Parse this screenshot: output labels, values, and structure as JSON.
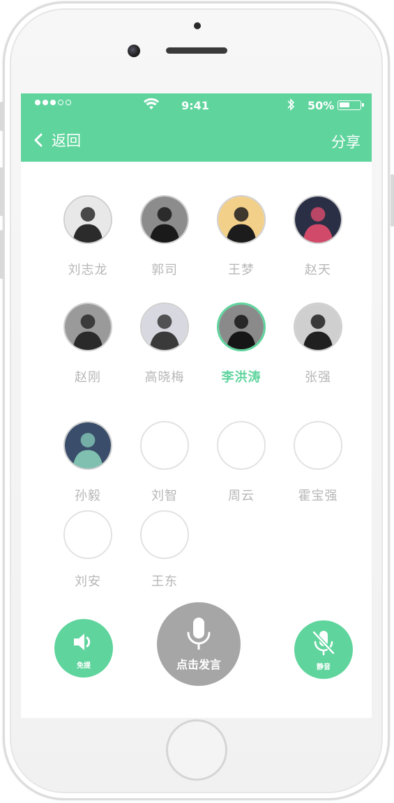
{
  "status_bar": {
    "carrier_dots": [
      "on",
      "on",
      "on",
      "off",
      "off"
    ],
    "time": "9:41",
    "battery_percent": "50%",
    "battery_level": 0.5
  },
  "nav": {
    "back_label": "返回",
    "share_label": "分享"
  },
  "members": [
    {
      "name": "刘志龙",
      "has_photo": true,
      "active": false
    },
    {
      "name": "郭司",
      "has_photo": true,
      "active": false
    },
    {
      "name": "王梦",
      "has_photo": true,
      "active": false
    },
    {
      "name": "赵天",
      "has_photo": true,
      "active": false
    },
    {
      "name": "赵刚",
      "has_photo": true,
      "active": false
    },
    {
      "name": "高晓梅",
      "has_photo": true,
      "active": false
    },
    {
      "name": "李洪涛",
      "has_photo": true,
      "active": true
    },
    {
      "name": "张强",
      "has_photo": true,
      "active": false
    },
    {
      "name": "孙毅",
      "has_photo": true,
      "active": false
    },
    {
      "name": "刘智",
      "has_photo": false,
      "active": false
    },
    {
      "name": "周云",
      "has_photo": false,
      "active": false
    },
    {
      "name": "霍宝强",
      "has_photo": false,
      "active": false
    },
    {
      "name": "刘安",
      "has_photo": false,
      "active": false
    },
    {
      "name": "王东",
      "has_photo": false,
      "active": false
    }
  ],
  "controls": {
    "speaker_label": "免提",
    "talk_label": "点击发言",
    "mute_label": "静音"
  },
  "colors": {
    "accent": "#5fd49d",
    "talk_button": "#a6a6a6",
    "name_text": "#b7b7b7"
  },
  "icons": [
    "back-chevron-icon",
    "wifi-icon",
    "bluetooth-icon",
    "battery-icon",
    "speaker-icon",
    "microphone-icon",
    "microphone-muted-icon"
  ]
}
